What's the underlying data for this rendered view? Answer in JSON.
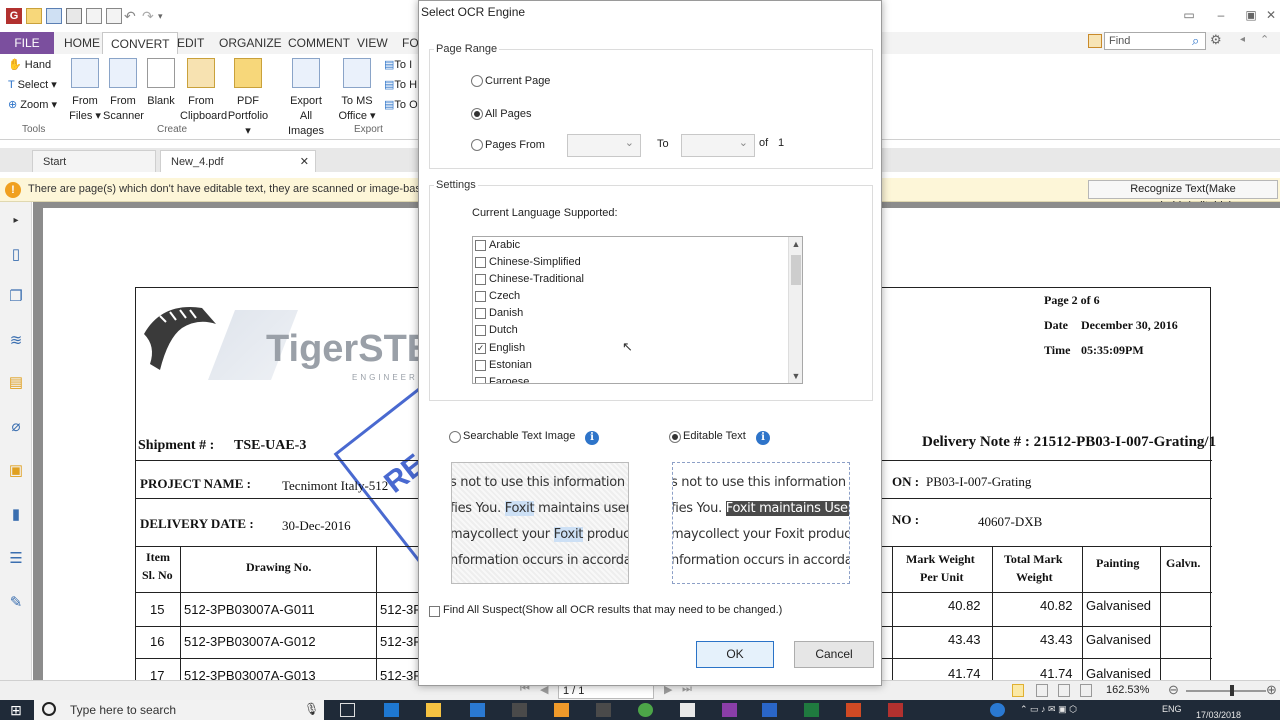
{
  "app": {
    "logo_letter": "G",
    "window_controls": [
      "▭",
      "–",
      "▣",
      "✕"
    ]
  },
  "ribbon": {
    "tabs": [
      "FILE",
      "HOME",
      "CONVERT",
      "EDIT",
      "ORGANIZE",
      "COMMENT",
      "VIEW",
      "FO"
    ],
    "active_tab": "CONVERT",
    "find_placeholder": "Find",
    "tools": {
      "hand": "Hand",
      "select": "Select",
      "zoom": "Zoom",
      "group_label": "Tools"
    },
    "create": {
      "from_files": [
        "From",
        "Files"
      ],
      "from_scanner": [
        "From",
        "Scanner"
      ],
      "blank": "Blank",
      "from_clipboard": [
        "From",
        "Clipboard"
      ],
      "pdf_portfolio": [
        "PDF",
        "Portfolio"
      ],
      "group_label": "Create"
    },
    "export": {
      "export_all_images": [
        "Export All",
        "Images"
      ],
      "to_ms_office": [
        "To MS",
        "Office"
      ],
      "to_items": [
        "To I",
        "To H",
        "To O"
      ],
      "group_label": "Export"
    }
  },
  "doc_tabs": [
    {
      "label": "Start"
    },
    {
      "label": "New_4.pdf",
      "close": "✕"
    }
  ],
  "notification": {
    "icon": "!",
    "text": "There are page(s) which don't have editable text, they are scanned or image-based.",
    "button": "Recognize Text(Make searchable/editable)"
  },
  "left_nav_icons": [
    "page-icon",
    "pages-icon",
    "layers-icon",
    "comments-icon",
    "attachment-icon",
    "lock-icon",
    "search-doc-icon",
    "form-icon",
    "tools-icon"
  ],
  "document": {
    "logo_text": "TigerSTEE",
    "logo_sub": "ENGINEERIN",
    "page_info": "Page 2 of 6",
    "date_label": "Date",
    "date_value": "December 30, 2016",
    "time_label": "Time",
    "time_value": "05:35:09PM",
    "shipment_label": "Shipment # :",
    "shipment_value": "TSE-UAE-3",
    "delivery_note": "Delivery Note # : 21512-PB03-I-007-Grating/1",
    "project_label": "PROJECT NAME :",
    "project_value": "Tecnimont Italy-512",
    "project_right_label": "ON :",
    "project_right_value": "PB03-I-007-Grating",
    "delivery_date_label": "DELIVERY DATE :",
    "delivery_date_value": "30-Dec-2016",
    "no_label": "NO :",
    "no_value": "40607-DXB",
    "stamp_text": "REC",
    "columns": {
      "item": [
        "Item",
        "Sl. No"
      ],
      "drawing": "Drawing No.",
      "mark_weight": [
        "Mark Weight",
        "Per Unit"
      ],
      "total_mark": [
        "Total Mark",
        "Weight"
      ],
      "painting": "Painting",
      "galvn": "Galvn."
    },
    "rows": [
      {
        "item": "15",
        "drawing": "512-3PB03007A-G011",
        "drawing2": "512-3PB",
        "mark": "40.82",
        "total": "40.82",
        "painting": "Galvanised"
      },
      {
        "item": "16",
        "drawing": "512-3PB03007A-G012",
        "drawing2": "512-3PB",
        "mark": "43.43",
        "total": "43.43",
        "painting": "Galvanised"
      },
      {
        "item": "17",
        "drawing": "512-3PB03007A-G013",
        "drawing2": "512-3PB",
        "mark": "41.74",
        "total": "41.74",
        "painting": "Galvanised"
      }
    ]
  },
  "dialog": {
    "title": "Select OCR Engine",
    "page_range": {
      "legend": "Page Range",
      "current_page": "Current Page",
      "all_pages": "All Pages",
      "pages_from": "Pages From",
      "to": "To",
      "of": "of",
      "total": "1",
      "selected": "all_pages"
    },
    "settings": {
      "legend": "Settings",
      "language_label": "Current Language Supported:",
      "languages": [
        {
          "name": "Arabic",
          "checked": false
        },
        {
          "name": "Chinese-Simplified",
          "checked": false
        },
        {
          "name": "Chinese-Traditional",
          "checked": false
        },
        {
          "name": "Czech",
          "checked": false
        },
        {
          "name": "Danish",
          "checked": false
        },
        {
          "name": "Dutch",
          "checked": false
        },
        {
          "name": "English",
          "checked": true
        },
        {
          "name": "Estonian",
          "checked": false
        },
        {
          "name": "Faroese",
          "checked": false
        }
      ]
    },
    "output": {
      "searchable": "Searchable Text Image",
      "editable": "Editable Text",
      "selected": "editable",
      "info_icon": "i"
    },
    "preview_lines": [
      [
        "s not to use this information in a",
        ""
      ],
      [
        "fies You. ",
        "Foxit",
        " maintains user logi"
      ],
      [
        "maycollect your ",
        "Foxit",
        " product log"
      ],
      [
        "nformation occurs in accordancew",
        ""
      ]
    ],
    "preview_text_lines": [
      [
        "s not to use this information in a",
        ""
      ],
      [
        "fies You. ",
        "Foxit maintains User",
        " logi"
      ],
      [
        "maycollect your Foxit product log",
        ""
      ],
      [
        "nformation occurs in accordancew",
        ""
      ]
    ],
    "find_suspect": "Find All Suspect(Show all OCR results that may need to be changed.)",
    "ok": "OK",
    "cancel": "Cancel"
  },
  "status": {
    "page_indicator": "1 / 1",
    "zoom": "162.53%"
  },
  "taskbar": {
    "search_placeholder": "Type here to search",
    "lang": "ENG",
    "date": "17/03/2018"
  }
}
